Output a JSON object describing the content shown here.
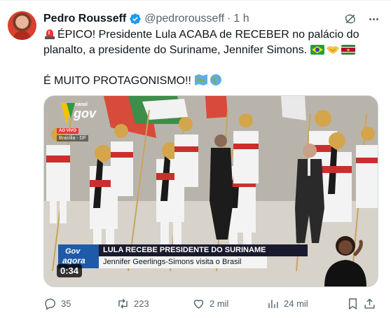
{
  "author": {
    "name": "Pedro Rousseff",
    "handle": "@pedrorousseff",
    "separator": "·",
    "time": "1 h"
  },
  "post": {
    "line1_text": "ÉPICO! Presidente Lula ACABA de RECEBER no palácio do planalto, a presidente do Suriname, Jennifer Simons.",
    "line2_text": "É MUITO PROTAGONISMO!!",
    "emojis": [
      "rotating-light",
      "flag-brazil",
      "handshake",
      "flag-suriname",
      "map",
      "globe"
    ]
  },
  "video": {
    "channel_small": "canal",
    "channel_big": "gov",
    "live_badge": "AO VIVO",
    "location": "Brasília - DF",
    "lower_third_logo_top": "Gov",
    "lower_third_logo_bottom": "agora",
    "headline": "LULA RECEBE PRESIDENTE DO SURINAME",
    "subheadline": "Jennifer Geerlings-Simons visita o Brasil",
    "duration": "0:34"
  },
  "actions": {
    "replies": "35",
    "reposts": "223",
    "likes": "2 mil",
    "views": "24 mil"
  },
  "colors": {
    "text": "#0f1419",
    "muted": "#536471",
    "verified": "#1d9bf0"
  }
}
